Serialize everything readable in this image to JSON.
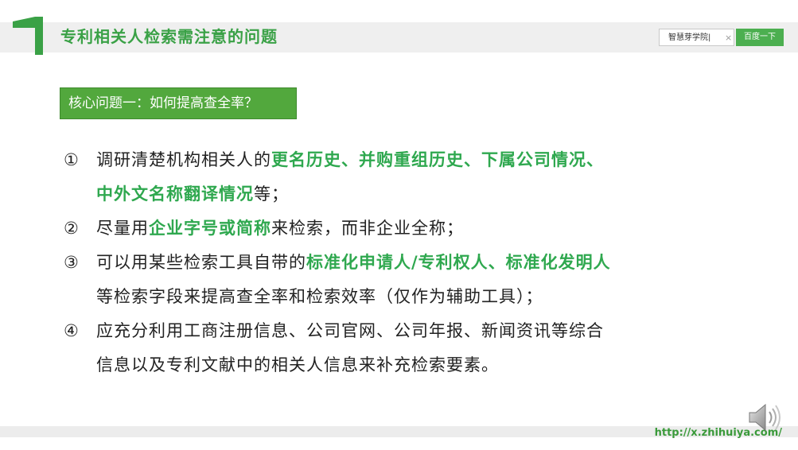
{
  "header": {
    "page_title": "专利相关人检索需注意的问题"
  },
  "search": {
    "query": "智慧芽学院|",
    "button_label": "百度一下",
    "clear_glyph": "×"
  },
  "core_question": {
    "label": "核心问题一：如何提高查全率？"
  },
  "items": [
    {
      "num": "①",
      "before": "调研清楚机构相关人的",
      "highlight": "更名历史、并购重组历史、下属公司情况、中外文名称翻译情况",
      "after": "等；"
    },
    {
      "num": "②",
      "before": "尽量用",
      "highlight": "企业字号或简称",
      "after": "来检索，而非企业全称；"
    },
    {
      "num": "③",
      "before": "可以用某些检索工具自带的",
      "highlight": "标准化申请人/专利权人、标准化发明人",
      "after": "等检索字段来提高查全率和检索效率（仅作为辅助工具）；"
    },
    {
      "num": "④",
      "before": "应充分利用工商注册信息、公司官网、公司年报、新闻资讯等综合信息以及专利文献中的相关人信息来补充检索要素。",
      "highlight": "",
      "after": ""
    }
  ],
  "footer": {
    "url": "http://x.zhihuiya.com/"
  },
  "colors": {
    "accent_green": "#3aa146",
    "label_green": "#52a83d",
    "highlight_green": "#2fa84f",
    "search_button": "#4caf50"
  },
  "icons": {
    "section_number": "big-one-icon",
    "clear": "clear-icon",
    "audio": "speaker-icon"
  }
}
